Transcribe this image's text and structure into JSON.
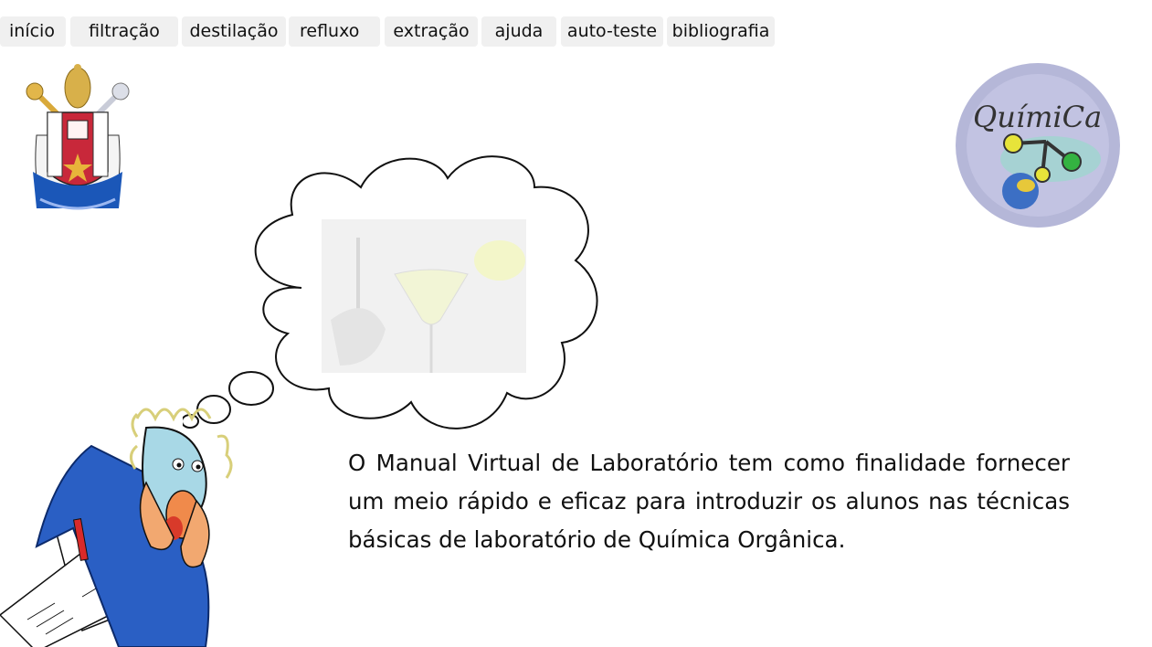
{
  "nav": {
    "tabs": [
      {
        "label": "início"
      },
      {
        "label": "filtração"
      },
      {
        "label": "destilação"
      },
      {
        "label": "refluxo"
      },
      {
        "label": "extração"
      },
      {
        "label": "ajuda"
      },
      {
        "label": "auto-teste"
      },
      {
        "label": "bibliografia"
      }
    ]
  },
  "logo_right": {
    "text": "QuímiCa"
  },
  "content": {
    "intro": "O Manual Virtual de Laboratório tem como finalidade fornecer um meio rápido e eficaz  para introduzir os alunos nas técnicas básicas de laboratório de Química Orgânica."
  },
  "colors": {
    "tab_bg": "#f0f0f0",
    "text": "#111111",
    "crest_red": "#c8283a",
    "crest_blue": "#1b57b8",
    "coat_blue": "#2a5fc4"
  },
  "icons": [
    "university-crest-logo",
    "quimica-logo",
    "thought-bubble",
    "lab-photo",
    "scientist-illustration"
  ]
}
